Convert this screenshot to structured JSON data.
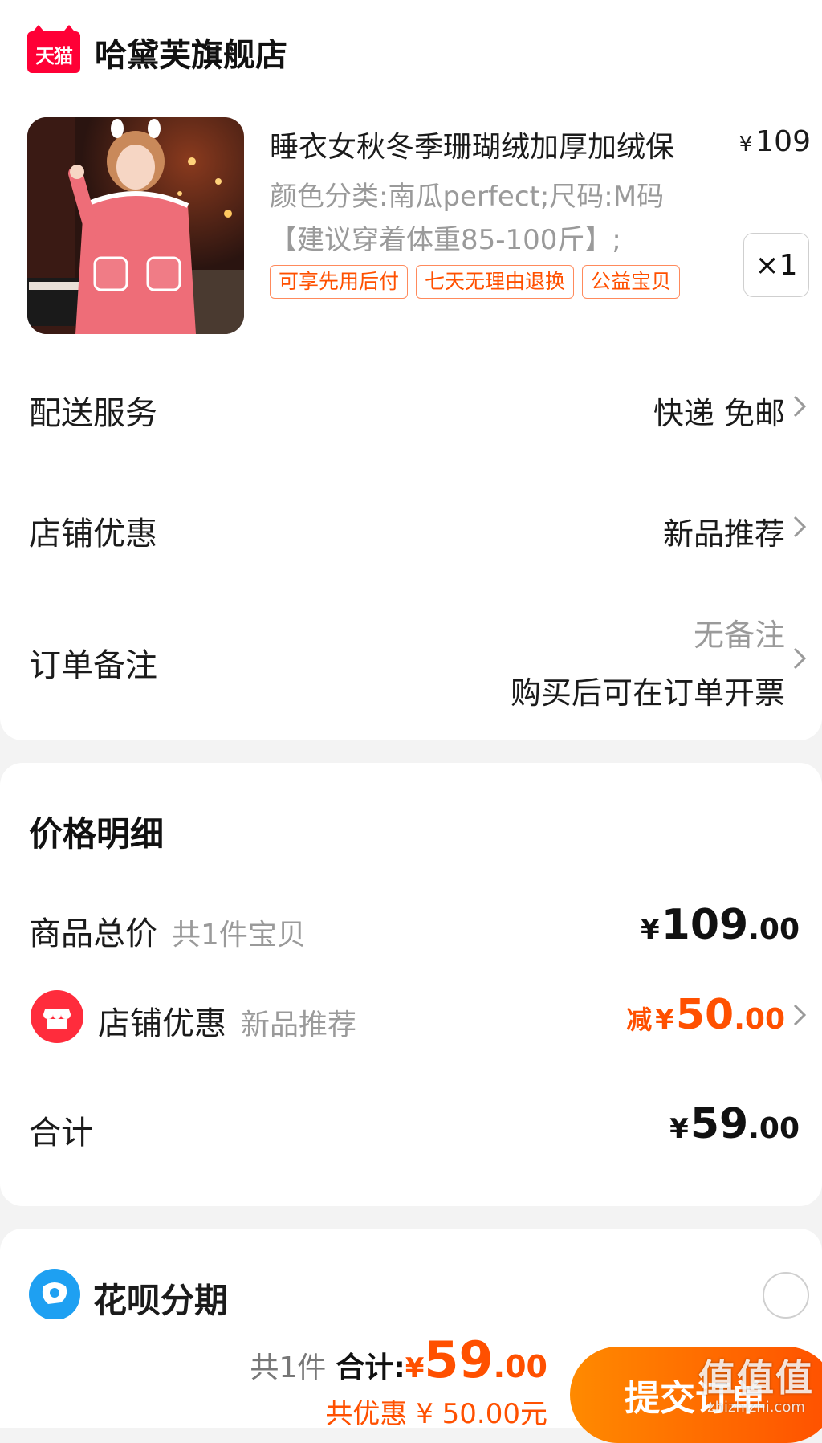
{
  "store": {
    "platform_logo_text": "天猫",
    "name": "哈黛芙旗舰店"
  },
  "product": {
    "title": "睡衣女秋冬季珊瑚绒加厚加绒保",
    "price_symbol": "¥",
    "price": "109",
    "sku_line1": "颜色分类:南瓜perfect;尺码:M码",
    "sku_line2": "【建议穿着体重85-100斤】;",
    "tags": [
      "可享先用后付",
      "七天无理由退换",
      "公益宝贝"
    ],
    "quantity": "×1"
  },
  "options": {
    "delivery": {
      "label": "配送服务",
      "value": "快递 免邮"
    },
    "store_discount": {
      "label": "店铺优惠",
      "value": "新品推荐"
    },
    "order_note": {
      "label": "订单备注",
      "placeholder": "无备注",
      "invoice": "购买后可在订单开票"
    }
  },
  "price_detail": {
    "title": "价格明细",
    "goods_total": {
      "label": "商品总价",
      "sub": "共1件宝贝",
      "symbol": "¥",
      "int": "109",
      "dec": ".00"
    },
    "store_discount": {
      "label": "店铺优惠",
      "sub": "新品推荐",
      "prefix": "减",
      "symbol": "¥",
      "int": "50",
      "dec": ".00"
    },
    "total": {
      "label": "合计",
      "symbol": "¥",
      "int": "59",
      "dec": ".00"
    }
  },
  "payment": {
    "huabei_label": "花呗分期"
  },
  "bottom_bar": {
    "count_text": "共1件",
    "total_label": "合计:",
    "symbol": "¥",
    "int": "59",
    "dec": ".00",
    "discount_text": "共优惠 ¥ 50.00元",
    "submit_label": "提交订单"
  },
  "watermark": {
    "main": "值值值",
    "sub": "zhizhizhi.com"
  },
  "colors": {
    "accent": "#ff5000",
    "tmall_red": "#ff0036",
    "huabei_blue": "#1ea0f2"
  }
}
